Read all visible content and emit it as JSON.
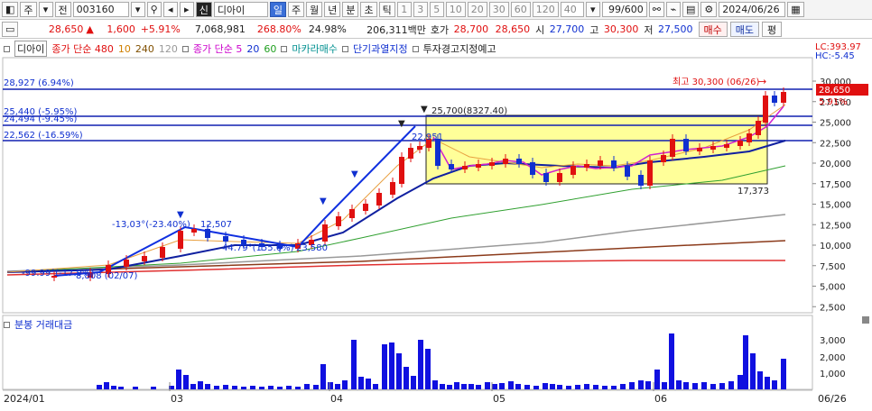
{
  "toolbar": {
    "code": "003160",
    "name": "디아이",
    "periods": [
      "일",
      "주",
      "월",
      "년",
      "분",
      "초",
      "틱"
    ],
    "minutes": [
      "1",
      "3",
      "5",
      "10",
      "20",
      "30",
      "60",
      "120"
    ],
    "min_field": "40",
    "count": "99/600",
    "date": "2024/06/26",
    "labels": {
      "ju": "주",
      "jeon": "전",
      "sin": "신"
    }
  },
  "infobar": {
    "price": "28,650",
    "change_sign": "▲",
    "change": "1,600",
    "change_pct": "+5.91%",
    "volume": "7,068,981",
    "vol_ratio": "268.80%",
    "turnover": "24.98%",
    "amount": "206,311백만",
    "ask_label": "호가",
    "ask": "28,700",
    "bid": "28,650",
    "open_label": "시",
    "open": "27,700",
    "high_label": "고",
    "high": "30,300",
    "low_label": "저",
    "low": "27,500",
    "buy": "매수",
    "sell": "매도",
    "flat": "평"
  },
  "legend": {
    "name": "디아이",
    "ma1": "종가 단순 480",
    "ma1b": "10",
    "ma1c": "240",
    "ma1d": "120",
    "ma2": "종가 단순 5",
    "ma2b": "20",
    "ma2c": "60",
    "macro": "마카라매수",
    "short": "단기과열지정",
    "warn": "투자경고지정예고"
  },
  "price_panel": {
    "lc": "LC:393.97",
    "hc": "HC:-5.45",
    "current": "28,650",
    "current_pct": "5.91%",
    "high_note": "최고 30,300 (06/26)",
    "low_note": "17,373",
    "box_note": "25,700(8327.40)",
    "left_notes": [
      "28,927 (6.94%)",
      "25,440 (-5.95%)",
      "24,494 (-9.45%)",
      "22,562 (-16.59%)"
    ],
    "wave_notes": [
      "-13,03°(-23.40%)",
      "12,507",
      "44.79°(155.6%)",
      "23,580",
      "22,951",
      "8,808 (02/07)",
      "-99.99°(-17.9%)"
    ],
    "y_ticks": [
      "30,000",
      "27,500",
      "25,000",
      "22,500",
      "20,000",
      "17,500",
      "15,000",
      "12,500",
      "10,000",
      "7,500",
      "5,000",
      "2,500"
    ]
  },
  "volume_panel": {
    "title": "분봉 거래대금",
    "y_ticks": [
      "3,000",
      "2,000",
      "1,000"
    ]
  },
  "x_axis": {
    "labels": [
      "2024/01",
      "03",
      "04",
      "05",
      "06"
    ],
    "last": "06/26"
  },
  "colors": {
    "up": "#e01010",
    "down": "#1030d0",
    "box": "#ffff99"
  }
}
